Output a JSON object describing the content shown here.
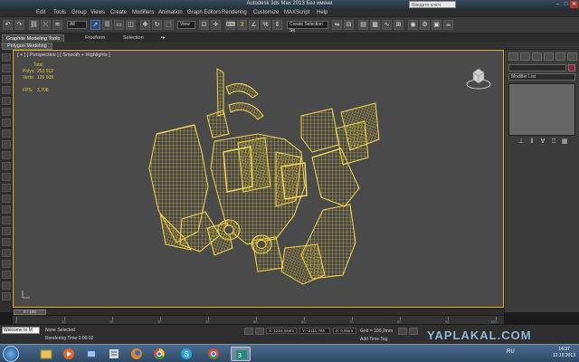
{
  "titlebar": {
    "title": "Autodesk 3ds Max 2013     Без имени",
    "search_placeholder": "Введите ключ. слово",
    "min": "–",
    "max": "□",
    "close": "✕"
  },
  "menubar": {
    "items": [
      "Edit",
      "Tools",
      "Group",
      "Views",
      "Create",
      "Modifiers",
      "Animation",
      "Graph Editors",
      "Rendering",
      "Customize",
      "MAXScript",
      "Help"
    ]
  },
  "toolbar": {
    "selection_filter": "All",
    "ref_coord": "View",
    "named_selection": "Create Selection Se"
  },
  "ribbon": {
    "tabs": [
      "Graphite Modeling Tools",
      "Freeform",
      "Selection"
    ],
    "subtab": "Polygon Modeling"
  },
  "viewport": {
    "label": "[ + ] [ Perspective ] [ Smooth + Highlights ]",
    "stats": {
      "total_label": "Total",
      "polys_label": "Polys:",
      "polys_value": "253 912",
      "verts_label": "Verts:",
      "verts_value": "126 608",
      "fps_label": "FPS:",
      "fps_value": "3,708"
    },
    "colors": {
      "wire": "#e8c933",
      "background": "#4a4a4a",
      "border": "#e3b21d"
    }
  },
  "command_panel": {
    "modifier_list": "Modifier List"
  },
  "timeline": {
    "slider_label": "0 / 100",
    "ticks": [
      "0",
      "10",
      "20",
      "30",
      "40",
      "50",
      "60",
      "70",
      "80",
      "90",
      "100"
    ]
  },
  "statusbar": {
    "maxscript_text": "Welcome to M",
    "status_text": "None Selected",
    "render_time": "Rendering Time  0:00:02",
    "x_value": "X: 1224,164m",
    "y_value": "Y: -2111,784",
    "z_value": "Z: 0,0mm",
    "grid": "Grid = 100,0mm",
    "add_time_tag": "Add Time Tag"
  },
  "taskbar": {
    "lang": "RU",
    "clock_time": "14:37",
    "clock_date": "12.10.2013"
  },
  "watermark": "YAPLAKAL.COM"
}
